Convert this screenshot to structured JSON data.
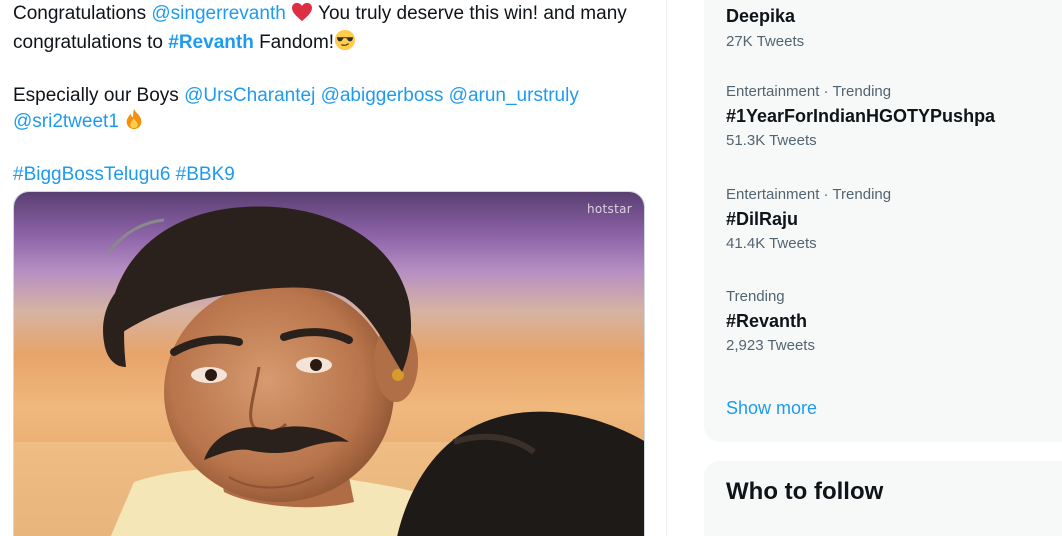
{
  "tweet": {
    "line1": {
      "pre": "Congratulations ",
      "mention": "@singerrevanth",
      "post": " You truly deserve this win! and many"
    },
    "line2": {
      "pre": "congratulations to ",
      "hashtag": "#Revanth",
      "post": " Fandom!"
    },
    "line3": {
      "pre": "Especially our Boys ",
      "mention1": "@UrsCharantej",
      "mention2": "@abiggerboss",
      "mention3": "@arun_urstruly"
    },
    "line4": {
      "mention": "@sri2tweet1"
    },
    "hashtags": {
      "tag1": "#BiggBossTelugu6",
      "tag2": "#BBK9"
    },
    "media": {
      "watermark": "hotstar"
    }
  },
  "trends": [
    {
      "meta": "",
      "name": "Deepika",
      "count": "27K Tweets"
    },
    {
      "meta": "Entertainment · Trending",
      "name": "#1YearForIndianHGOTYPushpa",
      "count": "51.3K Tweets"
    },
    {
      "meta": "Entertainment · Trending",
      "name": "#DilRaju",
      "count": "41.4K Tweets"
    },
    {
      "meta": "Trending",
      "name": "#Revanth",
      "count": "2,923 Tweets"
    }
  ],
  "show_more": "Show more",
  "who_to_follow": "Who to follow",
  "colors": {
    "accent": "#1d9bf0",
    "text": "#0f1419",
    "secondary": "#536471",
    "panel": "#f7f9f9"
  }
}
